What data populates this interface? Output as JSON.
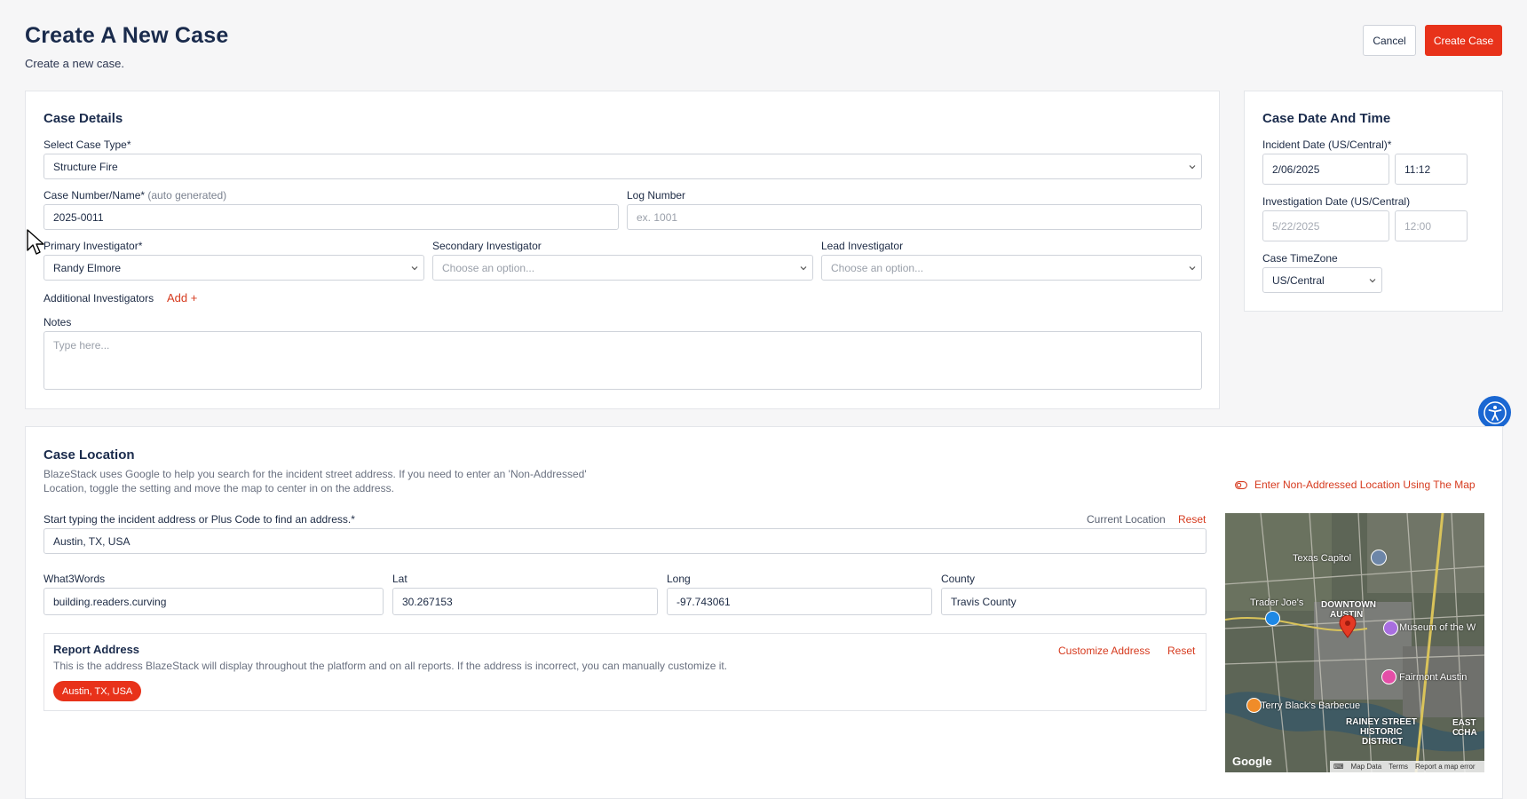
{
  "header": {
    "title": "Create A New Case",
    "subtitle": "Create a new case.",
    "cancel_label": "Cancel",
    "create_label": "Create Case"
  },
  "case_details": {
    "title": "Case Details",
    "case_type_label": "Select Case Type*",
    "case_type_value": "Structure Fire",
    "case_number_label": "Case Number/Name*",
    "case_number_hint": "(auto generated)",
    "case_number_value": "2025-0011",
    "log_number_label": "Log Number",
    "log_number_placeholder": "ex. 1001",
    "primary_label": "Primary Investigator*",
    "primary_value": "Randy Elmore",
    "secondary_label": "Secondary Investigator",
    "secondary_value": "Choose an option...",
    "lead_label": "Lead Investigator",
    "lead_value": "Choose an option...",
    "additional_label": "Additional Investigators",
    "add_label": "Add +",
    "notes_label": "Notes",
    "notes_placeholder": "Type here..."
  },
  "date_time": {
    "title": "Case Date And Time",
    "incident_label": "Incident Date (US/Central)*",
    "incident_date": "2/06/2025",
    "incident_time": "11:12",
    "investigation_label": "Investigation Date (US/Central)",
    "investigation_date": "5/22/2025",
    "investigation_time": "12:00",
    "timezone_label": "Case TimeZone",
    "timezone_value": "US/Central"
  },
  "location": {
    "title": "Case Location",
    "description_line1": "BlazeStack uses Google to help you search for the incident street address. If you need to enter an 'Non-Addressed'",
    "description_line2": "Location, toggle the setting and move the map to center in on the address.",
    "non_addressed_label": "Enter Non-Addressed Location Using The Map",
    "address_label": "Start typing the incident address or Plus Code to find an address.*",
    "current_location_label": "Current Location",
    "reset_label": "Reset",
    "address_value": "Austin, TX, USA",
    "w3w_label": "What3Words",
    "w3w_value": "building.readers.curving",
    "lat_label": "Lat",
    "lat_value": "30.267153",
    "long_label": "Long",
    "long_value": "-97.743061",
    "county_label": "County",
    "county_value": "Travis County",
    "report_address_title": "Report Address",
    "report_address_desc": "This is the address BlazeStack will display throughout the platform and on all reports. If the address is incorrect, you can manually customize it.",
    "customize_label": "Customize Address",
    "report_reset_label": "Reset",
    "report_address_value": "Austin, TX, USA"
  },
  "map": {
    "labels": {
      "capitol": "Texas Capitol",
      "downtown1": "DOWNTOWN",
      "downtown2": "AUSTIN",
      "traderjoes": "Trader Joe's",
      "museum": "Museum of the W",
      "fairmont": "Fairmont Austin",
      "terry": "Terry Black's Barbecue",
      "rainey1": "RAINEY STREET",
      "rainey2": "HISTORIC",
      "rainey3": "DISTRICT",
      "east1": "EAST C",
      "east2": "CHA",
      "google": "Google",
      "map_data": "Map Data",
      "terms": "Terms",
      "report_error": "Report a map error"
    }
  },
  "colors": {
    "brand_red": "#e8321a",
    "navy": "#1a2b4c",
    "accessibility_blue": "#1a67d2"
  }
}
